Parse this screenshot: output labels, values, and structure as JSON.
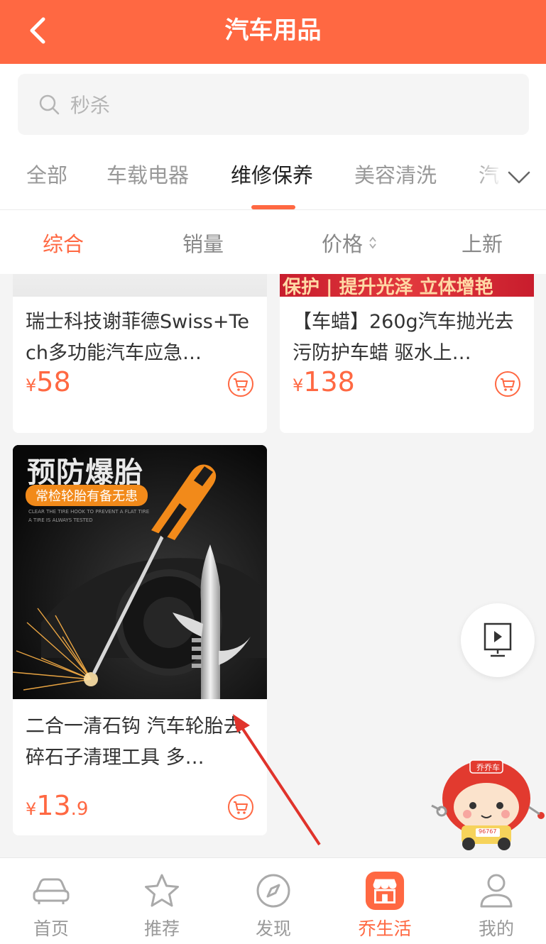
{
  "header": {
    "title": "汽车用品",
    "back_icon": "chevron-left-icon"
  },
  "search": {
    "placeholder": "秒杀",
    "icon": "search-icon"
  },
  "category_tabs": [
    {
      "label": "全部",
      "active": false
    },
    {
      "label": "车载电器",
      "active": false
    },
    {
      "label": "维修保养",
      "active": true
    },
    {
      "label": "美容清洗",
      "active": false
    },
    {
      "label": "汽",
      "active": false
    }
  ],
  "sort_bar": [
    {
      "label": "综合",
      "active": true
    },
    {
      "label": "销量",
      "active": false
    },
    {
      "label": "价格",
      "active": false
    },
    {
      "label": "上新",
      "active": false
    }
  ],
  "products": [
    {
      "title": "瑞士科技谢菲德Swiss+Tech多功能汽车应急…",
      "price_symbol": "¥",
      "price_int": "58",
      "price_dec": ""
    },
    {
      "title": "【车蜡】260g汽车抛光去污防护车蜡 驱水上…",
      "banner_text": "保护 | 提升光泽 立体增艳",
      "price_symbol": "¥",
      "price_int": "138",
      "price_dec": ""
    },
    {
      "title": "二合一清石钩 汽车轮胎去碎石子清理工具 多…",
      "image_headline": "预防爆胎",
      "image_tag": "常检轮胎有备无患",
      "image_small_1": "CLEAR THE TIRE HOOK TO PREVENT A FLAT TIRE",
      "image_small_2": "A TIRE IS ALWAYS TESTED",
      "price_symbol": "¥",
      "price_int": "13",
      "price_dec": ".9"
    }
  ],
  "mascot": {
    "sign": "乔乔车",
    "plate": "96767"
  },
  "bottom_nav": [
    {
      "label": "首页",
      "icon": "car-icon",
      "active": false
    },
    {
      "label": "推荐",
      "icon": "star-icon",
      "active": false
    },
    {
      "label": "发现",
      "icon": "compass-icon",
      "active": false
    },
    {
      "label": "乔生活",
      "icon": "store-icon",
      "active": true
    },
    {
      "label": "我的",
      "icon": "user-icon",
      "active": false
    }
  ],
  "colors": {
    "accent": "#ff6842",
    "background": "#f4f4f4"
  }
}
